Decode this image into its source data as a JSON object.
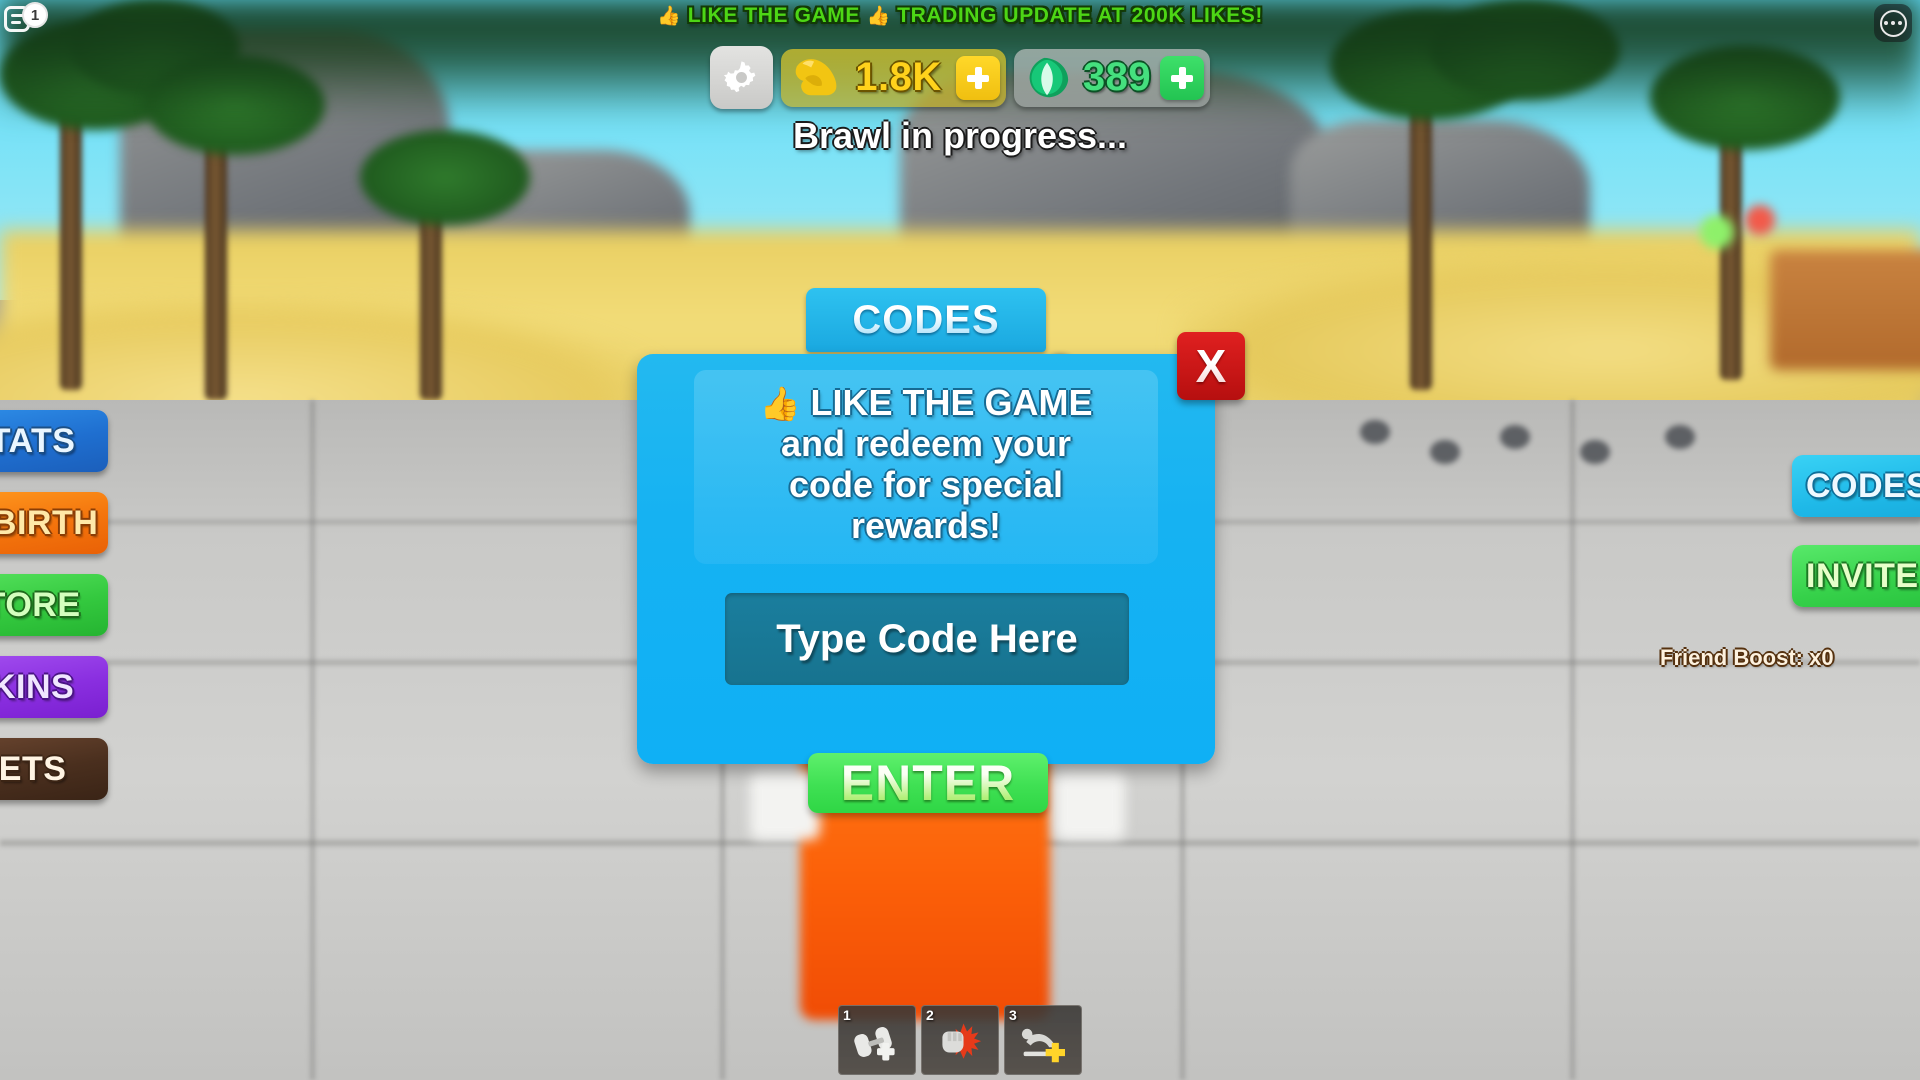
{
  "topbar": {
    "menu_badge": "1",
    "menu_icon": "roblox-menu-icon",
    "more_icon": "more-options-icon"
  },
  "banner": {
    "emoji_left": "👍",
    "text_left": "LIKE THE GAME",
    "emoji_right": "👍",
    "text_right": "TRADING UPDATE AT 200K LIKES!",
    "color": "#4dd615"
  },
  "hud": {
    "settings_icon": "gear-icon",
    "strength": {
      "icon": "flexed-biceps-icon",
      "value": "1.8K",
      "plus_label": "+",
      "color": "#ffd21c"
    },
    "gems": {
      "icon": "gem-icon",
      "value": "389",
      "plus_label": "+",
      "color": "#45e07e"
    }
  },
  "status": {
    "text": "Brawl in progress..."
  },
  "left_buttons": [
    {
      "label": "STATS",
      "theme": "stats"
    },
    {
      "label": "REBIRTH",
      "theme": "rebirth"
    },
    {
      "label": "STORE",
      "theme": "store"
    },
    {
      "label": "SKINS",
      "theme": "skins"
    },
    {
      "label": "PETS",
      "theme": "pets"
    }
  ],
  "right_buttons": [
    {
      "label": "CODES",
      "theme": "codes-side"
    },
    {
      "label": "INVITE",
      "theme": "invite"
    }
  ],
  "friend_boost": {
    "text": "Friend Boost: x0"
  },
  "codes_modal": {
    "title": "CODES",
    "message_emoji": "👍",
    "message_line1": "LIKE THE GAME",
    "message_line2": "and redeem your",
    "message_line3": "code for special",
    "message_line4": "rewards!",
    "input_placeholder": "Type Code Here",
    "input_value": "",
    "enter_label": "ENTER",
    "close_label": "X",
    "accent_color": "#16b2f2",
    "enter_color": "#3fe053",
    "close_color": "#c81414"
  },
  "hotbar": [
    {
      "num": "1",
      "icon": "dumbbell-weights-icon"
    },
    {
      "num": "2",
      "icon": "punch-impact-icon"
    },
    {
      "num": "3",
      "icon": "pushup-boost-icon"
    }
  ]
}
